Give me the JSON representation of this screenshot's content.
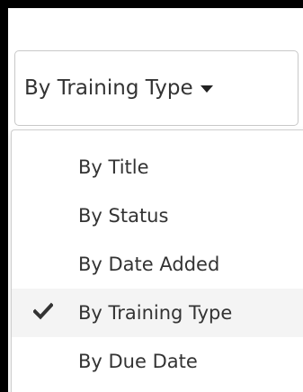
{
  "sort_dropdown": {
    "button_label": "By Training Type",
    "caret_icon": "caret-down-icon",
    "options": [
      {
        "label": "By Title",
        "selected": false
      },
      {
        "label": "By Status",
        "selected": false
      },
      {
        "label": "By Date Added",
        "selected": false
      },
      {
        "label": "By Training Type",
        "selected": true
      },
      {
        "label": "By Due Date",
        "selected": false
      }
    ],
    "selected_icon": "checkmark-icon",
    "colors": {
      "text": "#333333",
      "selected_background": "#f4f4f4",
      "border": "#c8c8c8",
      "frame": "#000000"
    }
  }
}
